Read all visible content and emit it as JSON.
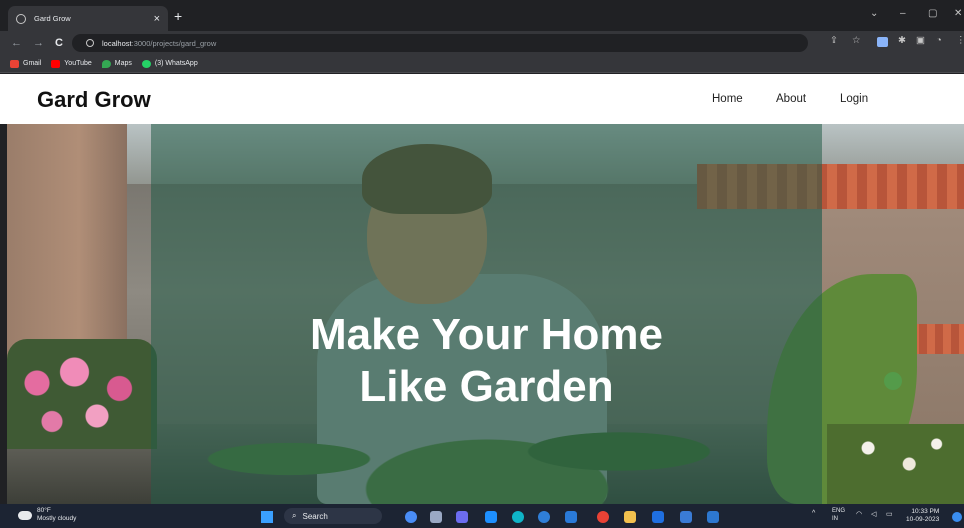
{
  "browser": {
    "tab_title": "Gard Grow",
    "tab_close": "×",
    "new_tab": "+",
    "url_host": "localhost",
    "url_path": ":3000/projects/gard_grow",
    "back": "←",
    "forward": "→",
    "reload": "C",
    "window_controls": {
      "dropdown": "⌄",
      "minimize": "–",
      "maximize": "▢",
      "close": "✕"
    },
    "bookmarks": [
      {
        "label": "Gmail",
        "color": "#ea4335"
      },
      {
        "label": "YouTube",
        "color": "#ff0000"
      },
      {
        "label": "Maps",
        "color": "#34a853"
      },
      {
        "label": "(3) WhatsApp",
        "color": "#25d366"
      }
    ]
  },
  "site": {
    "brand": "Gard Grow",
    "nav": {
      "home": "Home",
      "about": "About",
      "login": "Login"
    },
    "hero_heading_line1": "Make Your Home",
    "hero_heading_line2": "Like Garden"
  },
  "taskbar": {
    "weather_temp": "80°F",
    "weather_desc": "Mostly cloudy",
    "search_label": "Search",
    "lang_line1": "ENG",
    "lang_line2": "IN",
    "time": "10:33 PM",
    "date": "10-09-2023",
    "tray_chevron": "^"
  },
  "colors": {
    "accent_overlay": "#245c48",
    "brand_text": "#111111"
  }
}
